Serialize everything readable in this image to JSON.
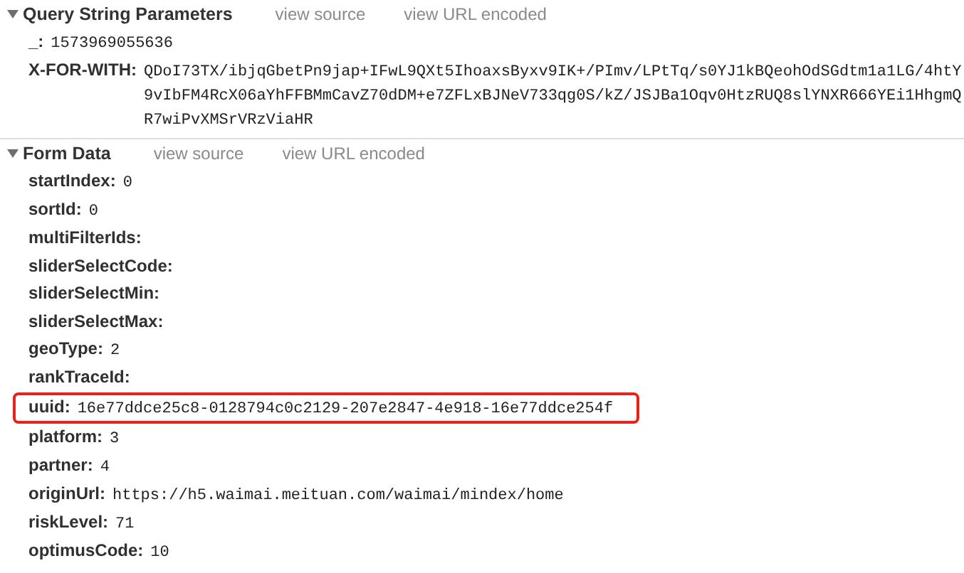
{
  "sections": [
    {
      "title": "Query String Parameters",
      "expanded": true,
      "links": [
        "view source",
        "view URL encoded"
      ],
      "params": [
        {
          "key": "_:",
          "value": "1573969055636",
          "highlighted": false
        },
        {
          "key": "X-FOR-WITH:",
          "value": "QDoI73TX/ibjqGbetPn9jap+IFwL9QXt5IhoaxsByxv9IK+/PImv/LPtTq/s0YJ1kBQeohOdSGdtm1a1LG/4htY9vIbFM4RcX06aYhFFBMmCavZ70dDM+e7ZFLxBJNeV733qg0S/kZ/JSJBa1Oqv0HtzRUQ8slYNXR666YEi1HhgmQR7wiPvXMSrVRzViaHR",
          "highlighted": false
        }
      ]
    },
    {
      "title": "Form Data",
      "expanded": true,
      "links": [
        "view source",
        "view URL encoded"
      ],
      "params": [
        {
          "key": "startIndex:",
          "value": "0",
          "highlighted": false
        },
        {
          "key": "sortId:",
          "value": "0",
          "highlighted": false
        },
        {
          "key": "multiFilterIds:",
          "highlighted": false
        },
        {
          "key": "sliderSelectCode:",
          "highlighted": false
        },
        {
          "key": "sliderSelectMin:",
          "highlighted": false
        },
        {
          "key": "sliderSelectMax:",
          "highlighted": false
        },
        {
          "key": "geoType:",
          "value": "2",
          "highlighted": false
        },
        {
          "key": "rankTraceId:",
          "highlighted": false
        },
        {
          "key": "uuid:",
          "value": "16e77ddce25c8-0128794c0c2129-207e2847-4e918-16e77ddce254f",
          "highlighted": true
        },
        {
          "key": "platform:",
          "value": "3",
          "highlighted": false
        },
        {
          "key": "partner:",
          "value": "4",
          "highlighted": false
        },
        {
          "key": "originUrl:",
          "value": "https://h5.waimai.meituan.com/waimai/mindex/home",
          "highlighted": false
        },
        {
          "key": "riskLevel:",
          "value": "71",
          "highlighted": false
        },
        {
          "key": "optimusCode:",
          "value": "10",
          "highlighted": false
        }
      ]
    }
  ]
}
